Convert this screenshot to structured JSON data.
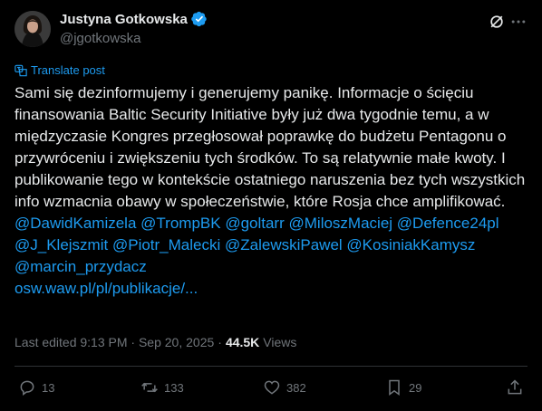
{
  "author": {
    "name": "Justyna Gotkowska",
    "handle": "@jgotkowska"
  },
  "translate_label": "Translate post",
  "post": {
    "text": "Sami się dezinformujemy i generujemy panikę. Informacje o ścięciu finansowania Baltic Security Initiative były już dwa tygodnie temu, a w międzyczasie Kongres przegłosował poprawkę do budżetu Pentagonu o przywróceniu i zwiększeniu tych środków. To są relatywnie małe kwoty. I publikowanie tego w kontekście ostatniego naruszenia bez tych wszystkich info wzmacnia obawy w społeczeństwie, które Rosja chce amplifikować.",
    "mentions": [
      "@DawidKamizela",
      "@TrompBK",
      "@goltarr",
      "@MiloszMaciej",
      "@Defence24pl",
      "@J_Klejszmit",
      "@Piotr_Malecki",
      "@ZalewskiPawel",
      "@KosiniakKamysz",
      "@marcin_przydacz"
    ],
    "link": "osw.waw.pl/pl/publikacje/..."
  },
  "meta": {
    "edited": "Last edited 9:13 PM · Sep 20, 2025",
    "separator": "·",
    "views_count": "44.5K",
    "views_label": "Views"
  },
  "actions": {
    "replies": "13",
    "reposts": "133",
    "likes": "382",
    "bookmarks": "29"
  },
  "colors": {
    "background": "#000000",
    "text": "#e7e9ea",
    "secondary": "#71767b",
    "accent": "#1d9bf0",
    "divider": "#2f3336"
  }
}
